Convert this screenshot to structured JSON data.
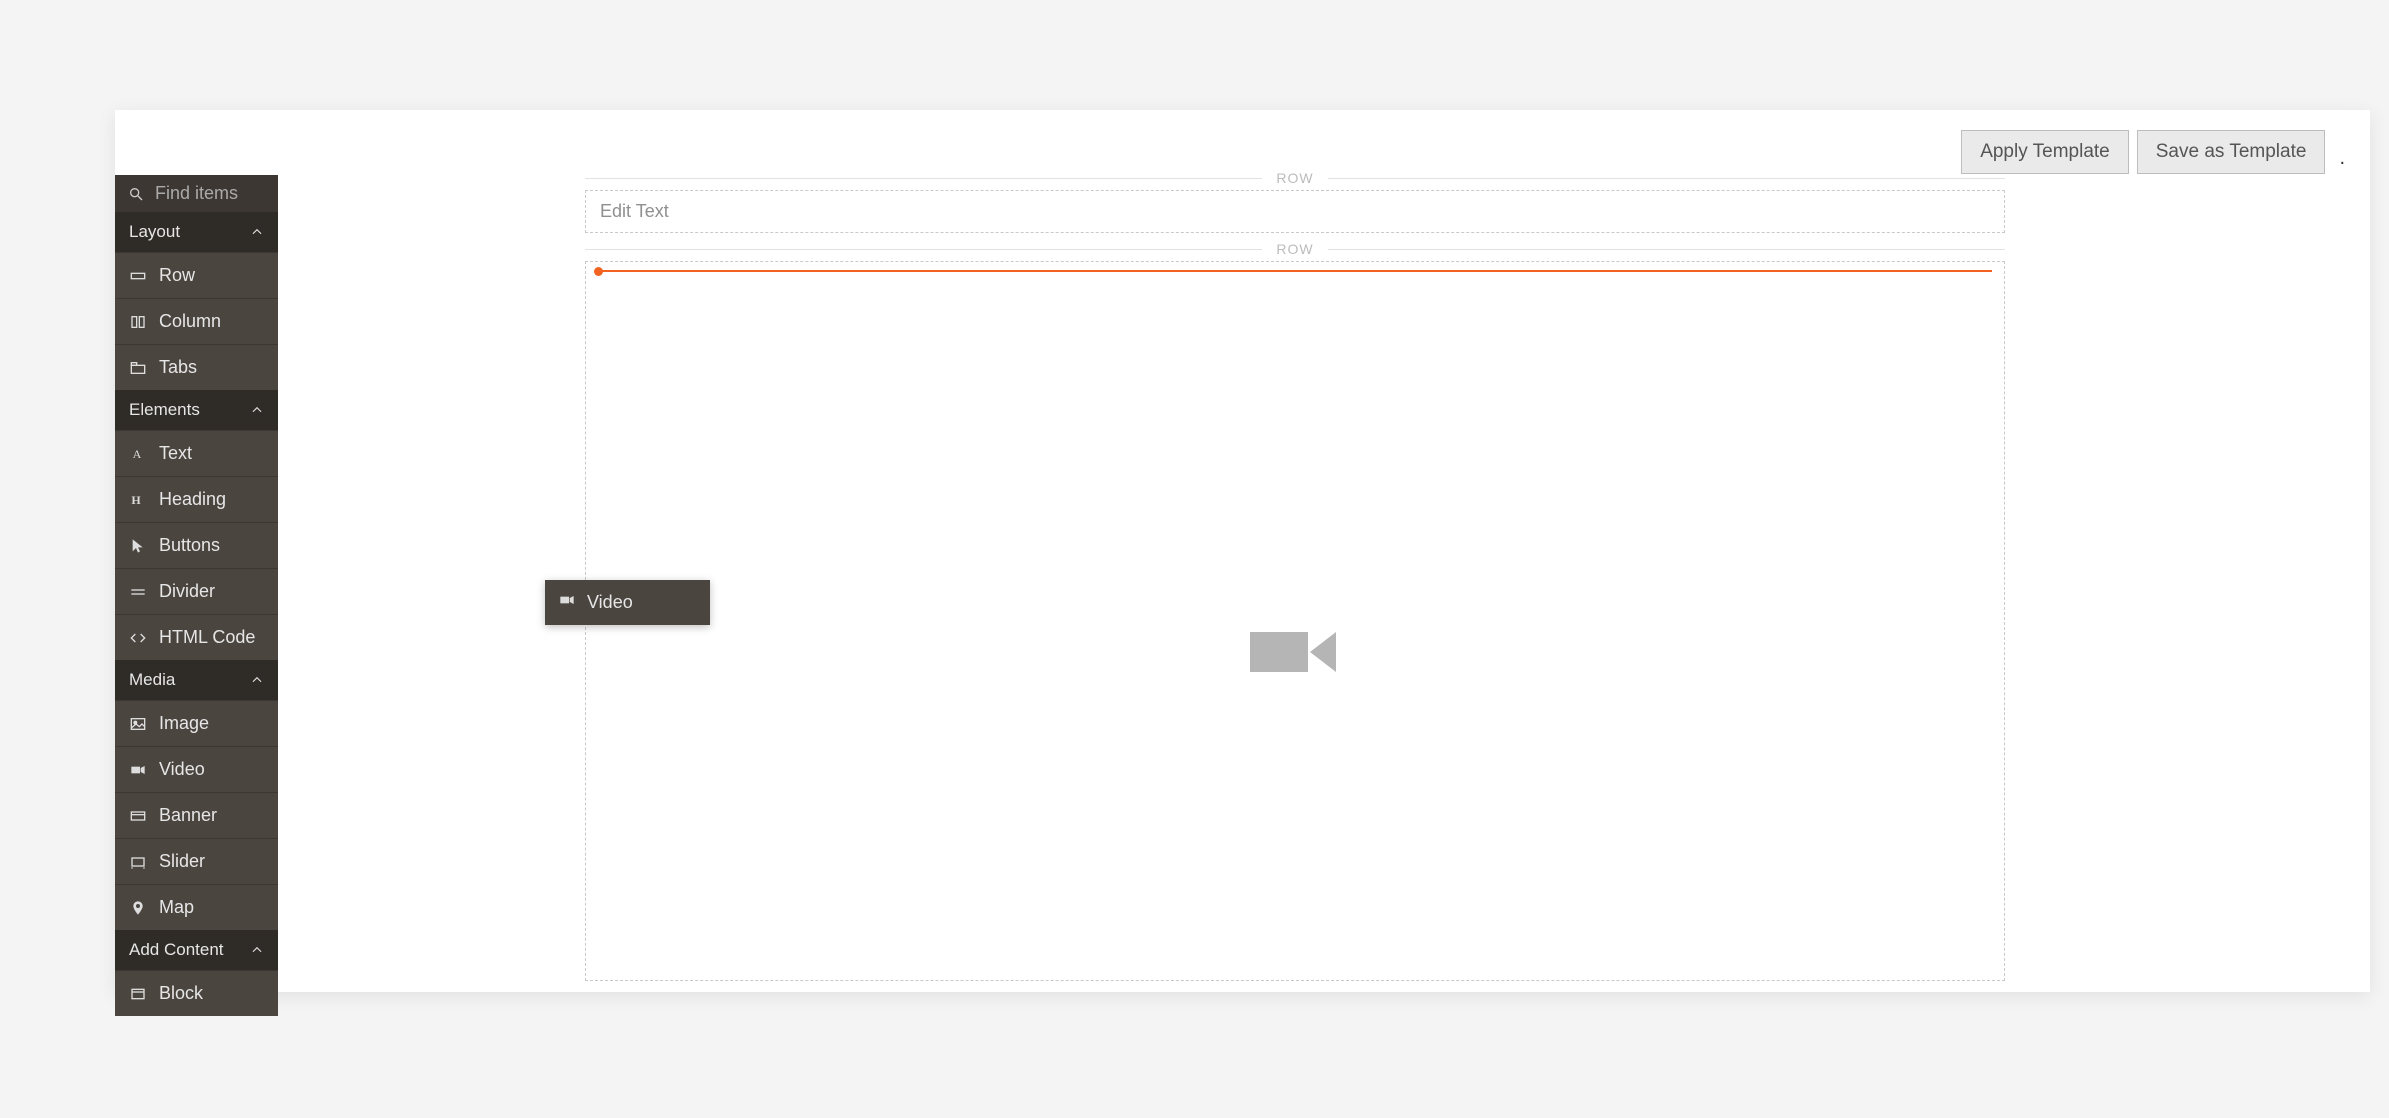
{
  "toolbar": {
    "apply_template": "Apply Template",
    "save_as_template": "Save as Template"
  },
  "sidebar": {
    "search_placeholder": "Find items",
    "groups": [
      {
        "label": "Layout",
        "items": [
          {
            "label": "Row"
          },
          {
            "label": "Column"
          },
          {
            "label": "Tabs"
          }
        ]
      },
      {
        "label": "Elements",
        "items": [
          {
            "label": "Text"
          },
          {
            "label": "Heading"
          },
          {
            "label": "Buttons"
          },
          {
            "label": "Divider"
          },
          {
            "label": "HTML Code"
          }
        ]
      },
      {
        "label": "Media",
        "items": [
          {
            "label": "Image"
          },
          {
            "label": "Video"
          },
          {
            "label": "Banner"
          },
          {
            "label": "Slider"
          },
          {
            "label": "Map"
          }
        ]
      },
      {
        "label": "Add Content",
        "items": [
          {
            "label": "Block"
          }
        ]
      }
    ]
  },
  "canvas": {
    "row_label": "ROW",
    "edit_text_placeholder": "Edit Text"
  },
  "drag": {
    "label": "Video"
  },
  "colors": {
    "accent": "#f26322",
    "sidebar_bg": "#3c3732",
    "sidebar_item_bg": "#4b4540"
  }
}
